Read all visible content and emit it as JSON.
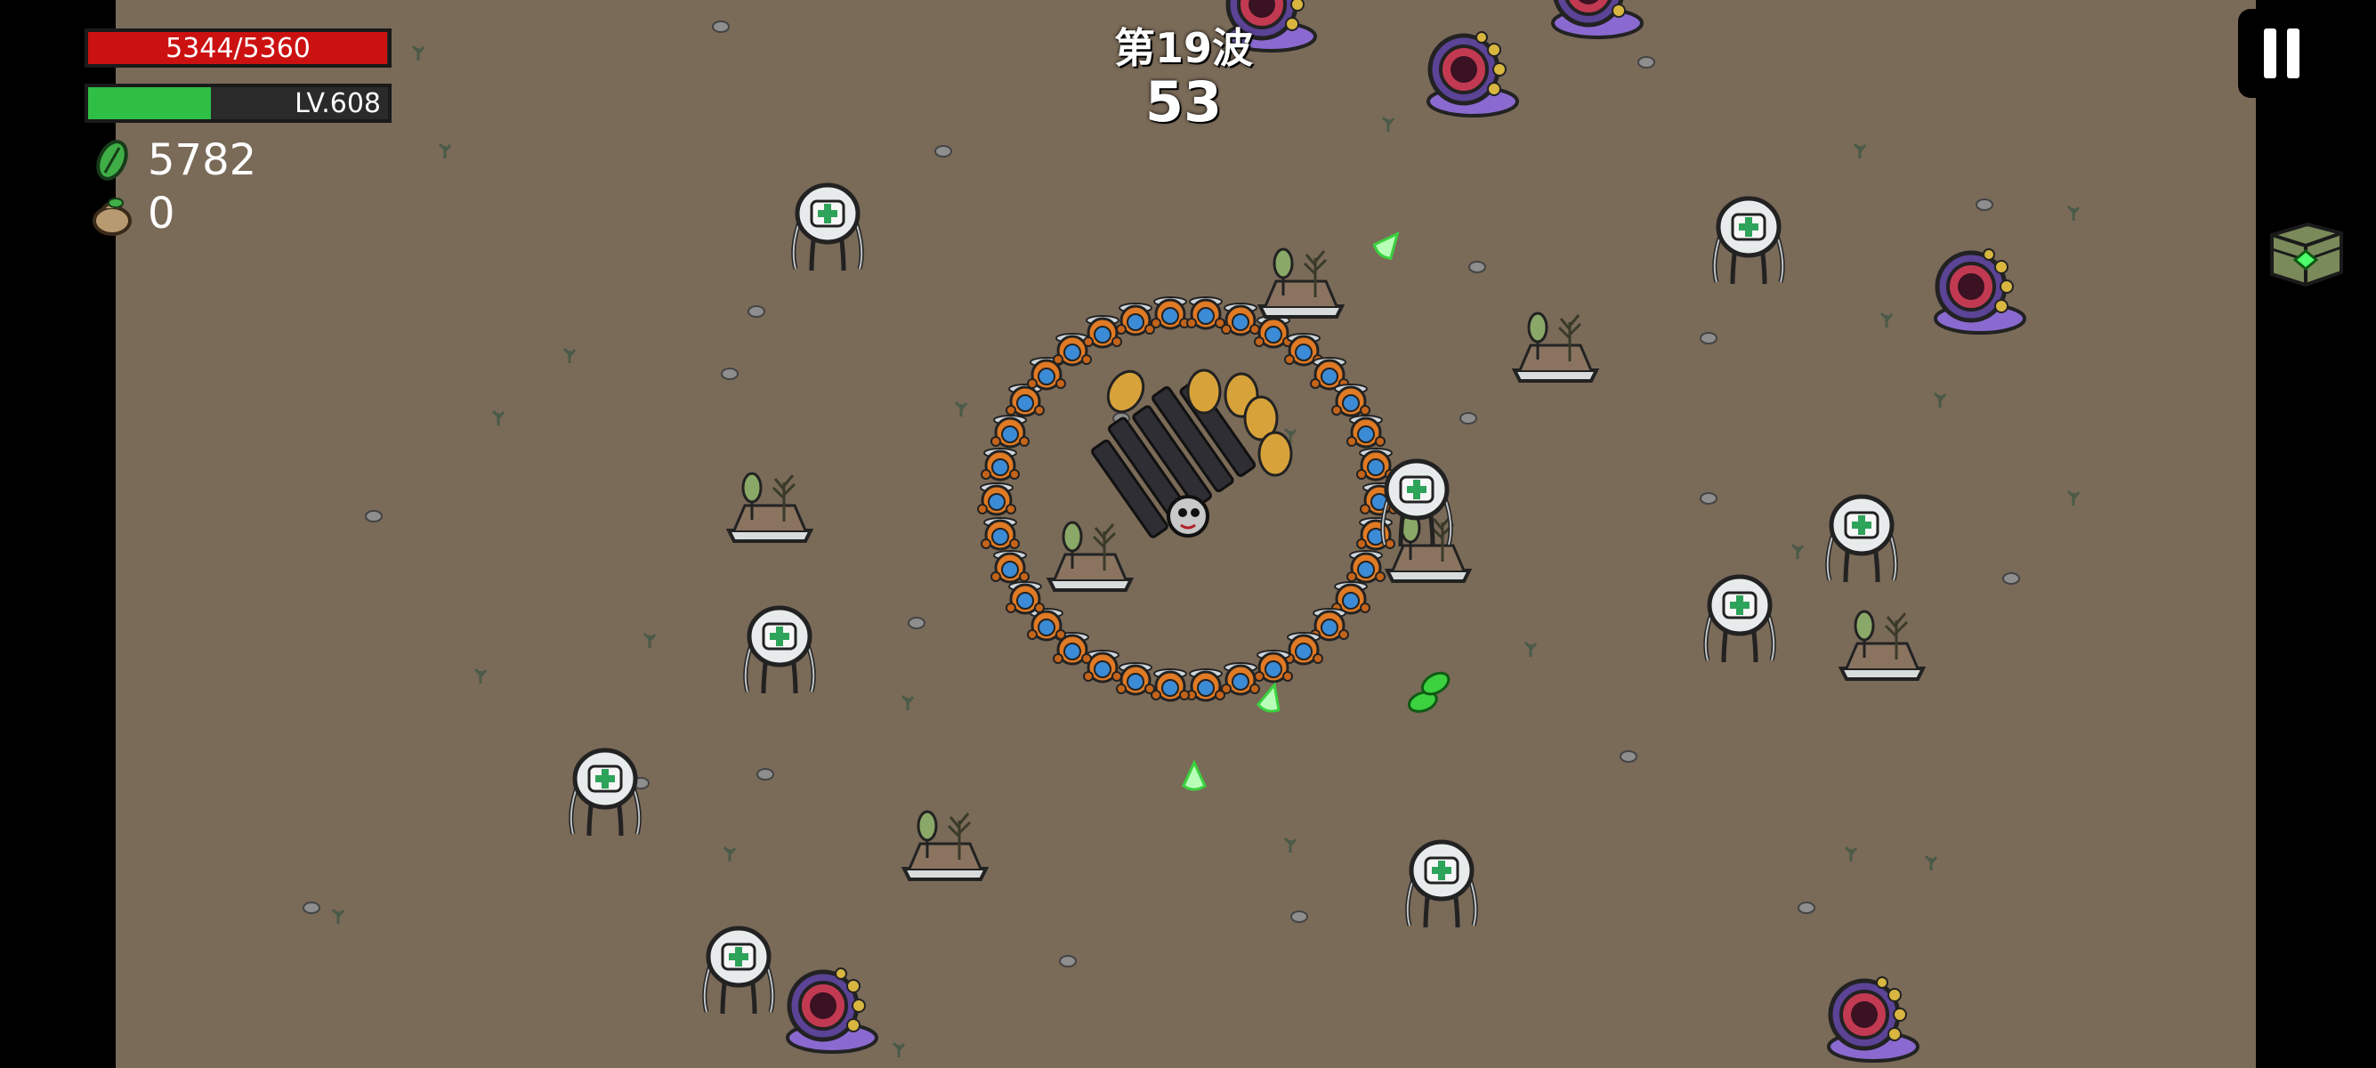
{
  "hud": {
    "health_text": "5344/5360",
    "health_fraction": 0.997,
    "level_text": "LV.608",
    "xp_fraction": 0.41,
    "materials": "5782",
    "bag": "0",
    "health_color": "#cc1111",
    "xp_color": "#2fbf45"
  },
  "wave": {
    "title": "第19波",
    "timer": "53"
  },
  "controls": {
    "pause_icon": "pause-icon",
    "crate_icon": "loot-crate-icon"
  },
  "colors": {
    "ground": "#7a6a58",
    "enemy_purple": "#6a4aa8",
    "turret_orange": "#e07a24",
    "projectile_green": "#58f05a"
  }
}
